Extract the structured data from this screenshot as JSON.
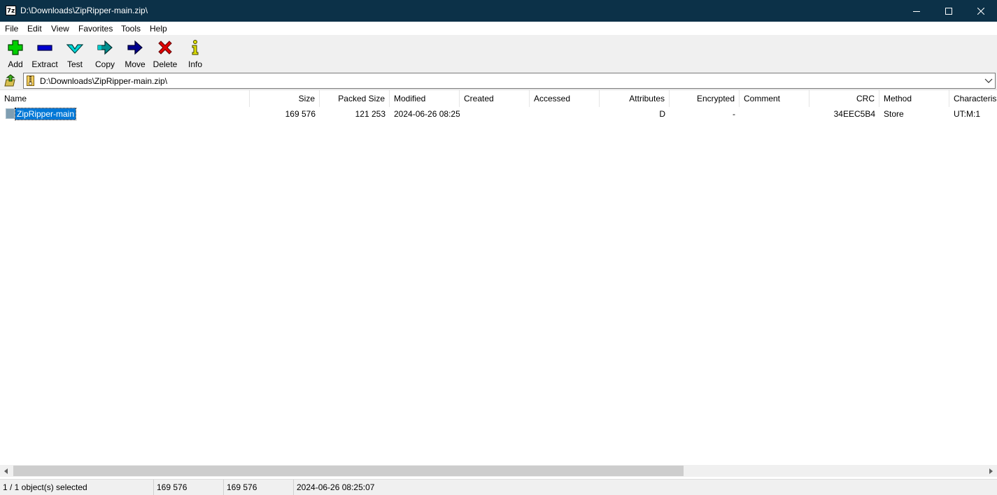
{
  "window": {
    "app_icon": "7z",
    "title": "D:\\Downloads\\ZipRipper-main.zip\\",
    "title_bar_color": "#0c3148"
  },
  "menu": {
    "items": [
      "File",
      "Edit",
      "View",
      "Favorites",
      "Tools",
      "Help"
    ]
  },
  "toolbar": {
    "buttons": [
      {
        "label": "Add",
        "icon": "plus-icon",
        "color": "#00c800"
      },
      {
        "label": "Extract",
        "icon": "minus-icon",
        "color": "#0000c8"
      },
      {
        "label": "Test",
        "icon": "check-chevron-icon",
        "color": "#00c8c8"
      },
      {
        "label": "Copy",
        "icon": "arrow-right-icon",
        "color": "#008080"
      },
      {
        "label": "Move",
        "icon": "arrow-right-icon",
        "color": "#000080"
      },
      {
        "label": "Delete",
        "icon": "x-icon",
        "color": "#e00000"
      },
      {
        "label": "Info",
        "icon": "info-icon",
        "color": "#c8c800"
      }
    ]
  },
  "address": {
    "path": "D:\\Downloads\\ZipRipper-main.zip\\"
  },
  "columns": [
    "Name",
    "Size",
    "Packed Size",
    "Modified",
    "Created",
    "Accessed",
    "Attributes",
    "Encrypted",
    "Comment",
    "CRC",
    "Method",
    "Characteris"
  ],
  "rows": [
    {
      "name": "ZipRipper-main",
      "size": "169 576",
      "packed_size": "121 253",
      "modified": "2024-06-26 08:25",
      "created": "",
      "accessed": "",
      "attributes": "D",
      "encrypted": "-",
      "comment": "",
      "crc": "34EEC5B4",
      "method": "Store",
      "characteristics": "UT:M:1"
    }
  ],
  "status": {
    "selection": "1 / 1 object(s) selected",
    "size": "169 576",
    "packed_size": "169 576",
    "modified": "2024-06-26 08:25:07"
  },
  "colors": {
    "selection": "#0078d7",
    "title_bar": "#0c3148"
  }
}
